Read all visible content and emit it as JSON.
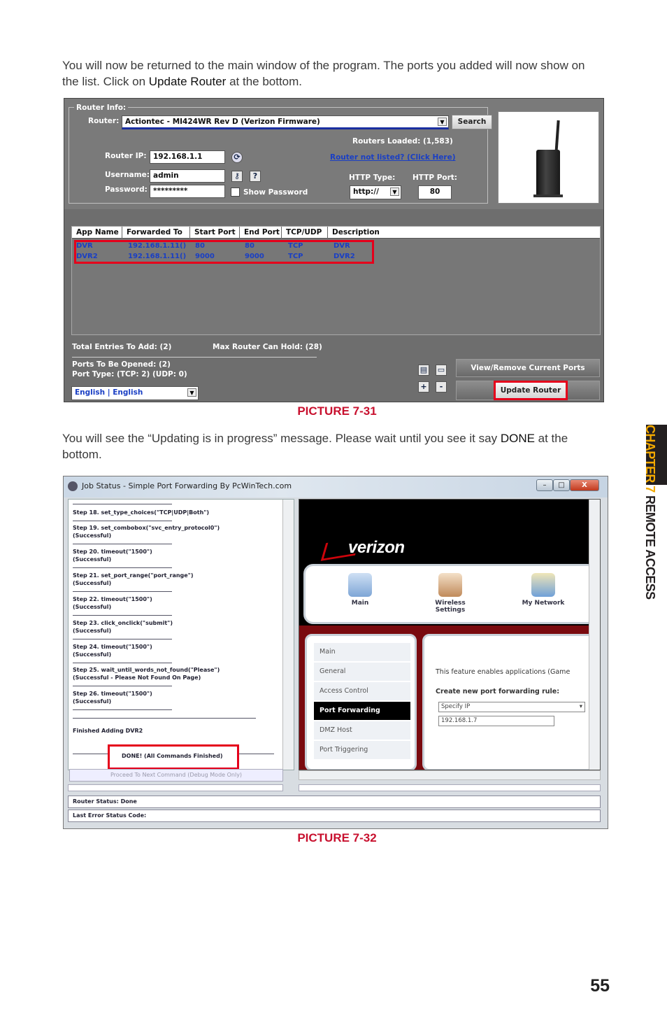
{
  "intro": {
    "text1": "You will now be returned to the main window of the program. The ports you added will now show on the list. Click on ",
    "bold1": "Update Router",
    "text2": " at the bottom."
  },
  "picture1": {
    "caption": "PICTURE 7-31",
    "router_info_label": "Router Info:",
    "router_label": "Router:",
    "router_value": "Actiontec - MI424WR Rev D (Verizon Firmware)",
    "search_button": "Search",
    "routers_loaded": "Routers Loaded: (1,583)",
    "router_ip_label": "Router IP:",
    "router_ip_value": "192.168.1.1",
    "not_listed_link": "Router not listed? (Click Here)",
    "username_label": "Username:",
    "username_value": "admin",
    "password_label": "Password:",
    "password_value": "*********",
    "show_password": "Show Password",
    "help_glyph": "?",
    "http_type_label": "HTTP Type:",
    "http_type_value": "http://",
    "http_port_label": "HTTP Port:",
    "http_port_value": "80",
    "table": {
      "headers": [
        "App Name",
        "Forwarded To",
        "Start Port",
        "End Port",
        "TCP/UDP",
        "Description"
      ],
      "rows": [
        [
          "DVR",
          "192.168.1.11()",
          "80",
          "80",
          "TCP",
          "DVR"
        ],
        [
          "DVR2",
          "192.168.1.11()",
          "9000",
          "9000",
          "TCP",
          "DVR2"
        ]
      ]
    },
    "total_entries": "Total Entries To Add: (2)",
    "max_router": "Max Router Can Hold: (28)",
    "ports_opened": "Ports To Be Opened: (2)",
    "port_type": "Port Type: (TCP: 2) (UDP: 0)",
    "language": "English | English",
    "view_remove_button": "View/Remove Current Ports",
    "update_router_button": "Update Router",
    "plus_glyph": "+",
    "minus_glyph": "-"
  },
  "middle": {
    "text1": "You will see the “Updating is in progress” message. Please wait until you see it say ",
    "bold1": "DONE",
    "text2": " at the bottom."
  },
  "picture2": {
    "caption": "PICTURE 7-32",
    "window_title": "Job Status - Simple Port Forwarding By PcWinTech.com",
    "log": [
      "Step 18. set_type_choices(\"TCP|UDP|Both\")",
      "Step 19. set_combobox(\"svc_entry_protocol0\")",
      "(Successful)",
      "Step 20. timeout(\"1500\")",
      "(Successful)",
      "Step 21. set_port_range(\"port_range\")",
      "(Successful)",
      "Step 22. timeout(\"1500\")",
      "(Successful)",
      "Step 23. click_onclick(\"submit\")",
      "(Successful)",
      "Step 24. timeout(\"1500\")",
      "(Successful)",
      "Step 25. wait_until_words_not_found(\"Please\")",
      "(Successful - Please Not Found On Page)",
      "Step 26. timeout(\"1500\")",
      "(Successful)"
    ],
    "finished": "Finished Adding DVR2",
    "done": "DONE! (All Commands Finished)",
    "proceed_button": "Proceed To Next Command (Debug Mode Only)",
    "router_status": "Router Status: Done",
    "last_error": "Last Error Status Code:",
    "brand": "verizon",
    "nav": [
      "Main",
      "Wireless Settings",
      "My Network"
    ],
    "menu": [
      "Main",
      "General",
      "Access Control",
      "Port Forwarding",
      "DMZ Host",
      "Port Triggering"
    ],
    "content_text": "This feature enables applications (Game",
    "content_heading": "Create new port forwarding rule:",
    "specify_ip": "Specify IP",
    "ip_value": "192.168.1.7",
    "win_min": "–",
    "win_max": "□",
    "win_close": "X"
  },
  "side_tab": {
    "chapter": "CHAPTER 7",
    "section": "REMOTE ACCESS"
  },
  "page_number": "55"
}
